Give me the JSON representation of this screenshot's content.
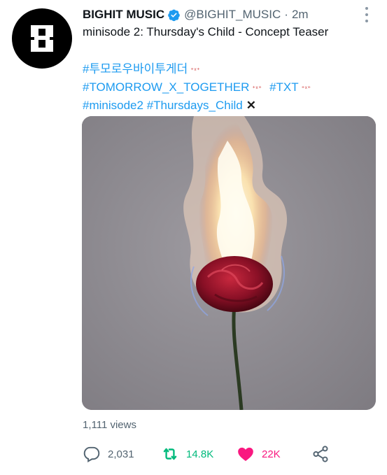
{
  "author": {
    "name": "BIGHIT MUSIC",
    "handle": "@BIGHIT_MUSIC",
    "separator": "·",
    "time": "2m",
    "verified": true
  },
  "tweet": {
    "text": "minisode 2: Thursday's Child - Concept Teaser",
    "hashtags": {
      "line1": {
        "tag1": "#투모로우바이투게더"
      },
      "line2": {
        "tag1": "#TOMORROW_X_TOGETHER",
        "tag2": "#TXT"
      },
      "line3": {
        "tag1": "#minisode2",
        "tag2": "#Thursdays_Child"
      }
    },
    "media": {
      "description_icon": "burning-rose-photo"
    }
  },
  "stats": {
    "views": "1,111 views",
    "replies": "2,031",
    "retweets": "14.8K",
    "likes": "22K"
  },
  "colors": {
    "link": "#1d9bf0",
    "retweet": "#00ba7c",
    "like": "#f91880",
    "muted": "#536471"
  },
  "icons": [
    "more-icon",
    "verified-icon",
    "reply-icon",
    "retweet-icon",
    "like-icon",
    "share-icon",
    "x-emoji-icon"
  ]
}
